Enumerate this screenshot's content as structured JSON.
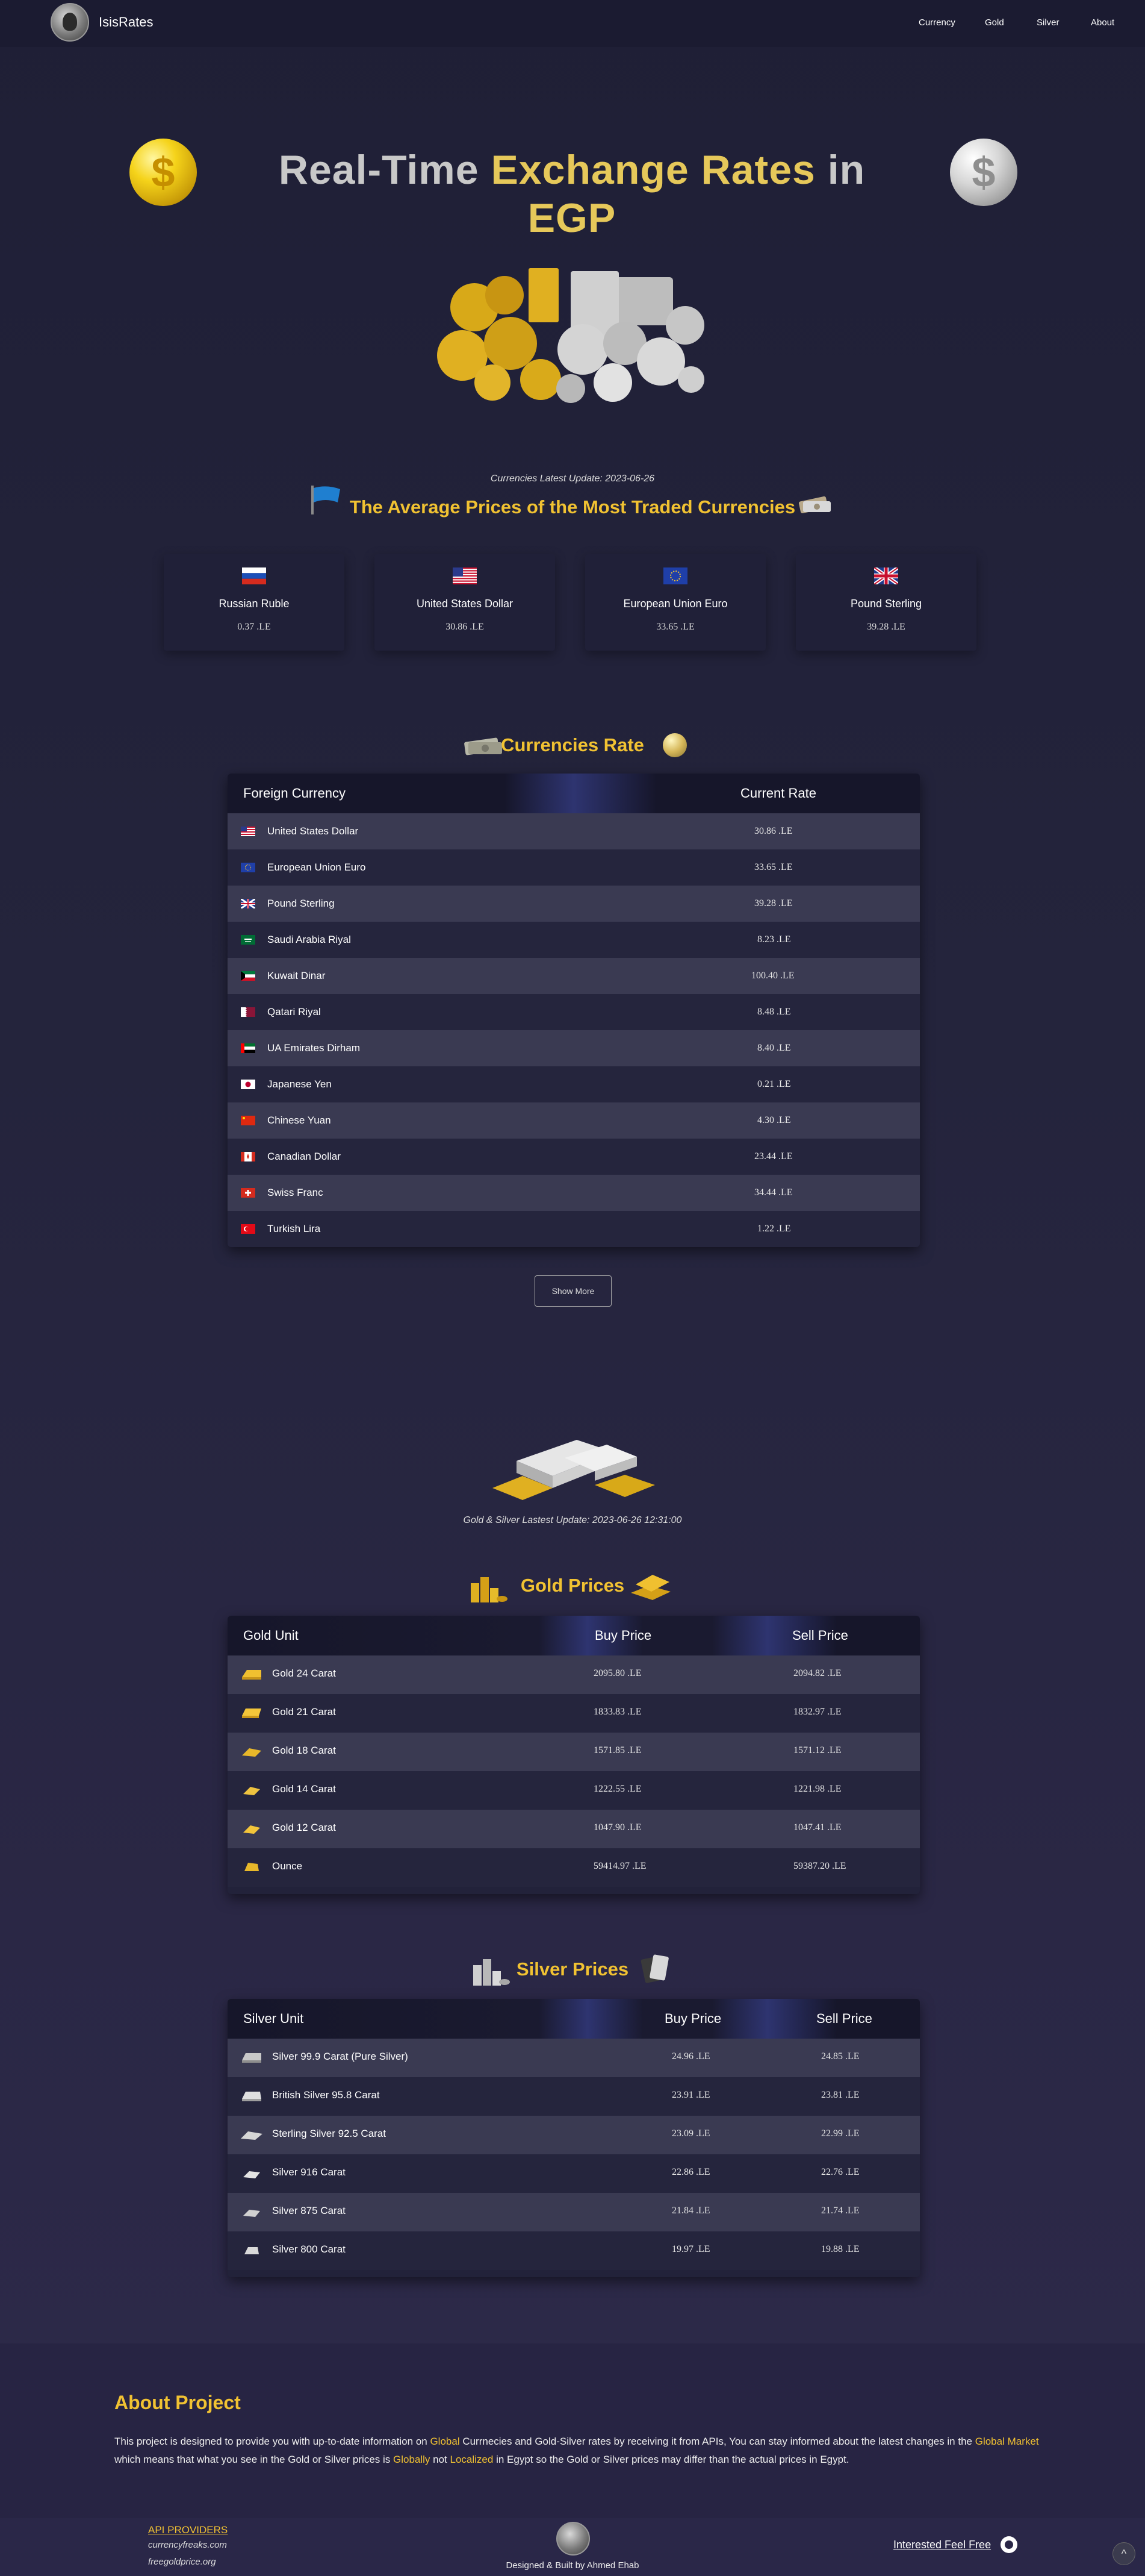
{
  "nav": {
    "brand": "IsisRates",
    "links": [
      "Currency",
      "Gold",
      "Silver",
      "About"
    ]
  },
  "hero": {
    "title_part1": "Real-Time ",
    "title_part2": "Exchange Rates",
    "title_part3": " in",
    "title_part4": "EGP",
    "gold_coin_symbol": "$",
    "silver_coin_symbol": "$"
  },
  "average": {
    "update_text": "Currencies Latest Update: 2023-06-26",
    "title": "The Average Prices of the Most Traded Currencies",
    "cards": [
      {
        "name": "Russian Ruble",
        "value": "0.37 .LE",
        "flag": "ru-flag"
      },
      {
        "name": "United States Dollar",
        "value": "30.86 .LE",
        "flag": "us-flag"
      },
      {
        "name": "European Union Euro",
        "value": "33.65 .LE",
        "flag": "eu-flag"
      },
      {
        "name": "Pound Sterling",
        "value": "39.28 .LE",
        "flag": "gb-flag"
      }
    ]
  },
  "currencies": {
    "title": "Currencies Rate",
    "headers": [
      "Foreign Currency",
      "Current Rate"
    ],
    "rows": [
      {
        "name": "United States Dollar",
        "rate": "30.86 .LE",
        "flag": "us-flag"
      },
      {
        "name": "European Union Euro",
        "rate": "33.65 .LE",
        "flag": "eu-flag"
      },
      {
        "name": "Pound Sterling",
        "rate": "39.28 .LE",
        "flag": "gb-flag"
      },
      {
        "name": "Saudi Arabia Riyal",
        "rate": "8.23 .LE",
        "flag": "sa-flag"
      },
      {
        "name": "Kuwait Dinar",
        "rate": "100.40 .LE",
        "flag": "kw-flag"
      },
      {
        "name": "Qatari Riyal",
        "rate": "8.48 .LE",
        "flag": "qa-flag"
      },
      {
        "name": "UA Emirates Dirham",
        "rate": "8.40 .LE",
        "flag": "ae-flag"
      },
      {
        "name": "Japanese Yen",
        "rate": "0.21 .LE",
        "flag": "jp-flag"
      },
      {
        "name": "Chinese Yuan",
        "rate": "4.30 .LE",
        "flag": "cn-flag"
      },
      {
        "name": "Canadian Dollar",
        "rate": "23.44 .LE",
        "flag": "ca-flag"
      },
      {
        "name": "Swiss Franc",
        "rate": "34.44 .LE",
        "flag": "ch-flag"
      },
      {
        "name": "Turkish Lira",
        "rate": "1.22 .LE",
        "flag": "tr-flag"
      }
    ],
    "show_more": "Show More"
  },
  "metals": {
    "update_text": "Gold & Silver Lastest Update: 2023-06-26 12:31:00"
  },
  "gold": {
    "title": "Gold Prices",
    "headers": [
      "Gold Unit",
      "Buy Price",
      "Sell Price"
    ],
    "rows": [
      {
        "name": "Gold 24 Carat",
        "buy": "2095.80 .LE",
        "sell": "2094.82 .LE"
      },
      {
        "name": "Gold 21 Carat",
        "buy": "1833.83 .LE",
        "sell": "1832.97 .LE"
      },
      {
        "name": "Gold 18 Carat",
        "buy": "1571.85 .LE",
        "sell": "1571.12 .LE"
      },
      {
        "name": "Gold 14 Carat",
        "buy": "1222.55 .LE",
        "sell": "1221.98 .LE"
      },
      {
        "name": "Gold 12 Carat",
        "buy": "1047.90 .LE",
        "sell": "1047.41 .LE"
      },
      {
        "name": "Ounce",
        "buy": "59414.97 .LE",
        "sell": "59387.20 .LE"
      }
    ]
  },
  "silver": {
    "title": "Silver Prices",
    "headers": [
      "Silver Unit",
      "Buy Price",
      "Sell Price"
    ],
    "rows": [
      {
        "name": "Silver 99.9 Carat (Pure Silver)",
        "buy": "24.96 .LE",
        "sell": "24.85 .LE"
      },
      {
        "name": "British Silver 95.8 Carat",
        "buy": "23.91 .LE",
        "sell": "23.81 .LE"
      },
      {
        "name": "Sterling Silver 92.5 Carat",
        "buy": "23.09 .LE",
        "sell": "22.99 .LE"
      },
      {
        "name": "Silver 916 Carat",
        "buy": "22.86 .LE",
        "sell": "22.76 .LE"
      },
      {
        "name": "Silver 875 Carat",
        "buy": "21.84 .LE",
        "sell": "21.74 .LE"
      },
      {
        "name": "Silver 800 Carat",
        "buy": "19.97 .LE",
        "sell": "19.88 .LE"
      }
    ]
  },
  "about": {
    "title": "About Project",
    "p1": "This project is designed to provide you with up-to-date information on ",
    "hl1": "Global",
    "p2": " Currnecies and Gold-Silver rates by receiving it from APIs, You can stay informed about the latest changes in the ",
    "hl2": "Global Market",
    "p3": " which means that what you see in the Gold or Silver prices is ",
    "hl3": "Globally",
    "p4": " not ",
    "hl4": "Localized",
    "p5": " in Egypt so the Gold or Silver prices may differ than the actual prices in Egypt."
  },
  "footer": {
    "api_title": "API PROVIDERS",
    "providers": [
      "currencyfreaks.com",
      "freegoldprice.org"
    ],
    "credit": "Designed & Built by Ahmed Ehab",
    "interested": "Interested Feel Free",
    "to_top": "^"
  },
  "colors": {
    "accent_gold": "#f1c232",
    "background": "#22223a",
    "row_alt": "#3a3a52"
  }
}
